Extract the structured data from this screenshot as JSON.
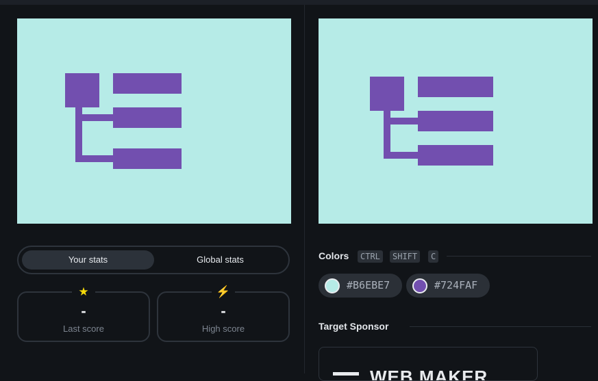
{
  "canvas": {
    "background": "#B6EBE7",
    "foreground": "#724FAF"
  },
  "stats": {
    "tabs": [
      {
        "label": "Your stats",
        "active": true
      },
      {
        "label": "Global stats",
        "active": false
      }
    ],
    "last_score": {
      "icon": "star-icon",
      "glyph": "★",
      "value": "-",
      "label": "Last score"
    },
    "high_score": {
      "icon": "lightning-icon",
      "glyph": "⚡",
      "value": "-",
      "label": "High score"
    }
  },
  "colors": {
    "title": "Colors",
    "shortcut": [
      "CTRL",
      "SHIFT",
      "C"
    ],
    "items": [
      {
        "hex": "#B6EBE7",
        "label": "#B6EBE7"
      },
      {
        "hex": "#724FAF",
        "label": "#724FAF"
      }
    ]
  },
  "sponsor": {
    "title": "Target Sponsor",
    "name": "WEB MAKER"
  }
}
